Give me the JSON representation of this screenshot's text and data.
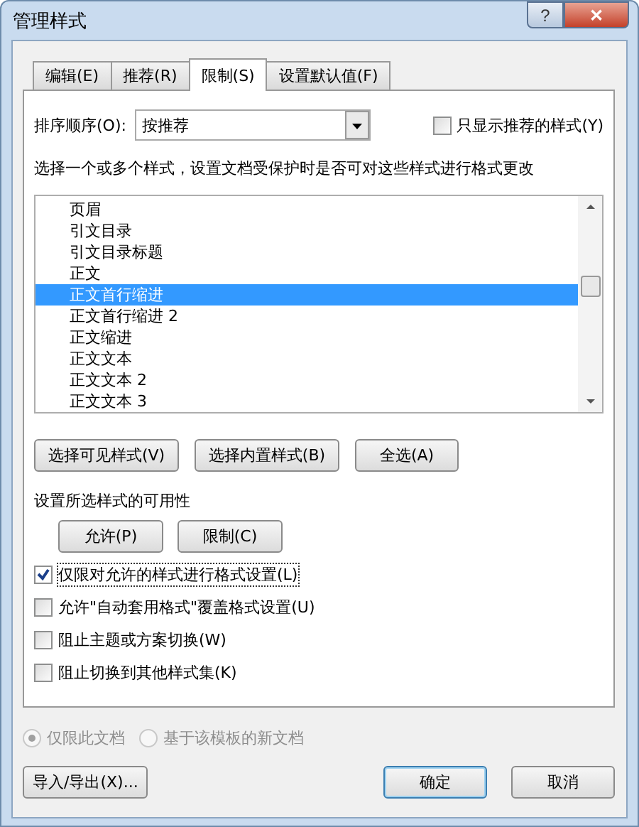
{
  "window": {
    "title": "管理样式",
    "help_button": "?",
    "close_button": "✕"
  },
  "tabs": [
    {
      "label": "编辑(E)",
      "selected": false
    },
    {
      "label": "推荐(R)",
      "selected": false
    },
    {
      "label": "限制(S)",
      "selected": true
    },
    {
      "label": "设置默认值(F)",
      "selected": false
    }
  ],
  "sort": {
    "label": "排序顺序(O):",
    "value": "按推荐"
  },
  "show_recommended_only": {
    "label": "只显示推荐的样式(Y)",
    "checked": false
  },
  "description": "选择一个或多个样式，设置文档受保护时是否可对这些样式进行格式更改",
  "styles": [
    {
      "name": "页眉",
      "selected": false
    },
    {
      "name": "引文目录",
      "selected": false
    },
    {
      "name": "引文目录标题",
      "selected": false
    },
    {
      "name": "正文",
      "selected": false
    },
    {
      "name": "正文首行缩进",
      "selected": true
    },
    {
      "name": "正文首行缩进 2",
      "selected": false
    },
    {
      "name": "正文缩进",
      "selected": false
    },
    {
      "name": "正文文本",
      "selected": false
    },
    {
      "name": "正文文本 2",
      "selected": false
    },
    {
      "name": "正文文本 3",
      "selected": false
    }
  ],
  "select_buttons": [
    "选择可见样式(V)",
    "选择内置样式(B)",
    "全选(A)"
  ],
  "availability_label": "设置所选样式的可用性",
  "availability_buttons": [
    "允许(P)",
    "限制(C)"
  ],
  "options": [
    {
      "label": "仅限对允许的样式进行格式设置(L)",
      "checked": true
    },
    {
      "label": "允许\"自动套用格式\"覆盖格式设置(U)",
      "checked": false
    },
    {
      "label": "阻止主题或方案切换(W)",
      "checked": false
    },
    {
      "label": "阻止切换到其他样式集(K)",
      "checked": false
    }
  ],
  "scope": [
    {
      "label": "仅限此文档",
      "selected": true,
      "disabled": true
    },
    {
      "label": "基于该模板的新文档",
      "selected": false,
      "disabled": true
    }
  ],
  "import_export_button": "导入/导出(X)...",
  "footer_buttons": [
    {
      "label": "确定",
      "default": true
    },
    {
      "label": "取消",
      "default": false
    }
  ]
}
